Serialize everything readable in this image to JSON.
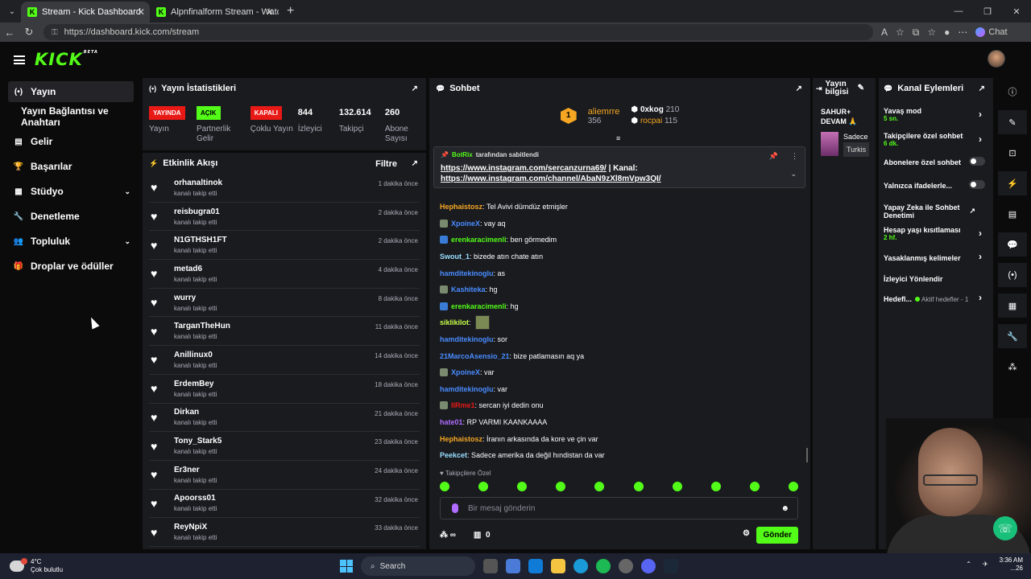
{
  "browser": {
    "tabs": [
      {
        "title": "Stream - Kick Dashboard",
        "fav": "K"
      },
      {
        "title": "Alpnfinalform Stream - Watch Live",
        "fav": "K"
      }
    ],
    "url": "https://dashboard.kick.com/stream",
    "copilot_label": "Chat"
  },
  "kick": {
    "logo": "KICK",
    "beta": "BETA"
  },
  "sidebar": {
    "items": [
      {
        "label": "Yayın",
        "icon": "(•)"
      },
      {
        "label": "Yayın Bağlantısı ve Anahtarı"
      },
      {
        "label": "Gelir",
        "icon": "▤"
      },
      {
        "label": "Başarılar",
        "icon": "🏆"
      },
      {
        "label": "Stüdyo",
        "icon": "▦",
        "chevron": "⌄"
      },
      {
        "label": "Denetleme",
        "icon": "🔧"
      },
      {
        "label": "Topluluk",
        "icon": "👥",
        "chevron": "⌄"
      },
      {
        "label": "Droplar ve ödüller",
        "icon": "🎁"
      }
    ]
  },
  "stats": {
    "title": "Yayın İstatistikleri",
    "items": [
      {
        "value": "YAYINDA",
        "label": "Yayın"
      },
      {
        "value": "AÇIK",
        "label": "Partnerlik Gelir"
      },
      {
        "value": "KAPALI",
        "label": "Çoklu Yayın"
      },
      {
        "value": "844",
        "label": "İzleyici"
      },
      {
        "value": "132.614",
        "label": "Takipçi"
      },
      {
        "value": "260",
        "label": "Abone Sayısı"
      }
    ]
  },
  "activity": {
    "title": "Etkinlik Akışı",
    "filter": "Filtre",
    "rows": [
      {
        "name": "orhanaltinok",
        "sub": "kanalı takip etti",
        "time": "1 dakika önce"
      },
      {
        "name": "reisbugra01",
        "sub": "kanalı takip etti",
        "time": "2 dakika önce"
      },
      {
        "name": "N1GTHSH1FT",
        "sub": "kanalı takip etti",
        "time": "2 dakika önce"
      },
      {
        "name": "metad6",
        "sub": "kanalı takip etti",
        "time": "4 dakika önce"
      },
      {
        "name": "wurry",
        "sub": "kanalı takip etti",
        "time": "8 dakika önce"
      },
      {
        "name": "TarganTheHun",
        "sub": "kanalı takip etti",
        "time": "11 dakika önce"
      },
      {
        "name": "Anillinux0",
        "sub": "kanalı takip etti",
        "time": "14 dakika önce"
      },
      {
        "name": "ErdemBey",
        "sub": "kanalı takip etti",
        "time": "18 dakika önce"
      },
      {
        "name": "Dirkan",
        "sub": "kanalı takip etti",
        "time": "21 dakika önce"
      },
      {
        "name": "Tony_Stark5",
        "sub": "kanalı takip etti",
        "time": "23 dakika önce"
      },
      {
        "name": "Er3ner",
        "sub": "kanalı takip etti",
        "time": "24 dakika önce"
      },
      {
        "name": "Apoorss01",
        "sub": "kanalı takip etti",
        "time": "32 dakika önce"
      },
      {
        "name": "ReyNpiX",
        "sub": "kanalı takip etti",
        "time": "33 dakika önce"
      }
    ]
  },
  "chat": {
    "title": "Sohbet",
    "leaders": {
      "first": {
        "rank": "1",
        "name": "aliemrre",
        "score": "356"
      },
      "second": {
        "name": "0xkog",
        "score": "210"
      },
      "third": {
        "name": "rocpai",
        "score": "115"
      }
    },
    "pinned": {
      "by": "BotRix",
      "by_suffix": "tarafından sabitlendi",
      "line1_link": "https://www.instagram.com/sercanzurna69/",
      "line1_suffix": "| Kanal:",
      "line2_link": "https://www.instagram.com/channel/AbaN9zXl8mVpw3QI/"
    },
    "messages": [
      {
        "user": "Hephaistosz",
        "text": "Tel Avivi dümdüz etmişler",
        "color": "#f5a623",
        "badge": ""
      },
      {
        "user": "XpoineX",
        "text": "vay aq",
        "color": "#4a8cff",
        "badge": "g"
      },
      {
        "user": "erenkaracimenli",
        "text": "ben görmedim",
        "color": "#53fc18",
        "badge": "b"
      },
      {
        "user": "Swout_1",
        "text": "bizede atın chate atın",
        "color": "#9adfff",
        "badge": ""
      },
      {
        "user": "hamditekinoglu",
        "text": "as",
        "color": "#4a8cff",
        "badge": ""
      },
      {
        "user": "Kashiteka",
        "text": "hg",
        "color": "#4a8cff",
        "badge": "g"
      },
      {
        "user": "erenkaracimenli",
        "text": "hg",
        "color": "#53fc18",
        "badge": "b"
      },
      {
        "user": "siklikilot",
        "text": "",
        "color": "#c6ff4a",
        "badge": "",
        "emote": true
      },
      {
        "user": "hamditekinoglu",
        "text": "sor",
        "color": "#4a8cff",
        "badge": ""
      },
      {
        "user": "21MarcoAsensio_21",
        "text": "bize patlamasın aq ya",
        "color": "#4a8cff",
        "badge": ""
      },
      {
        "user": "XpoineX",
        "text": "var",
        "color": "#4a8cff",
        "badge": "g"
      },
      {
        "user": "hamditekinoglu",
        "text": "var",
        "color": "#4a8cff",
        "badge": ""
      },
      {
        "user": "IIRme1",
        "text": "sercan iyi dedin onu",
        "color": "#e91916",
        "badge": "g"
      },
      {
        "user": "hate01",
        "text": "RP VARMI KAANKAAAA",
        "color": "#b16cff",
        "badge": ""
      },
      {
        "user": "Hephaistosz",
        "text": "İranın arkasında da kore ve çin var",
        "color": "#f5a623",
        "badge": ""
      },
      {
        "user": "Peekcet",
        "text": "Sadece amerika da değil hındistan da var",
        "color": "#9adfff",
        "badge": ""
      }
    ],
    "emote_header": "Takipçilere Özel",
    "placeholder": "Bir mesaj gönderin",
    "foot_infinity": "∞",
    "foot_count": "0",
    "send": "Gönder"
  },
  "info": {
    "title": "Yayın bilgisi",
    "stream_title": "SAHUR+ DEVAM 🙏",
    "category": "Sadece",
    "tag": "Turkis"
  },
  "actions": {
    "title": "Kanal Eylemleri",
    "slow_mode": {
      "label": "Yavaş mod",
      "value": "5 sn."
    },
    "followers_only": {
      "label": "Takipçilere özel sohbet",
      "value": "6 dk."
    },
    "subs_only": {
      "label": "Abonelere özel sohbet"
    },
    "emotes_only": {
      "label": "Yalnızca ifadelerle..."
    },
    "ai_mod": {
      "label": "Yapay Zeka ile Sohbet Denetimi"
    },
    "age": {
      "label": "Hesap yaşı kısıtlaması",
      "value": "2 hf."
    },
    "banned_words": {
      "label": "Yasaklanmış kelimeler"
    },
    "redirect": {
      "label": "İzleyici Yönlendir"
    },
    "goals": {
      "label": "Hedefl...",
      "sub": "Aktif hedefler - 1"
    }
  },
  "taskbar": {
    "temp": "4°C",
    "weather": "Çok bulutlu",
    "search": "Search",
    "time": "3:36 AM",
    "date": "...26"
  }
}
